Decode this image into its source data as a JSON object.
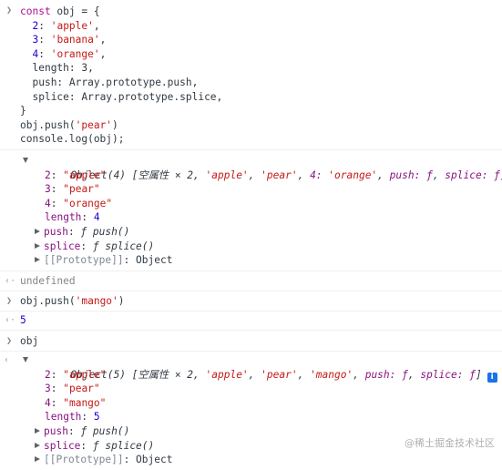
{
  "prompt_icon": "chevron-right-icon",
  "result_icon": "return-arrow-icon",
  "expand_icon": "expand-triangle-icon",
  "info_icon": "info-icon",
  "code1": {
    "l1_kw": "const",
    "l1_rest": " obj = {",
    "l2_num": "2",
    "l2_str": "'apple'",
    "l3_num": "3",
    "l3_str": "'banana'",
    "l4_num": "4",
    "l4_str": "'orange'",
    "l5": "length: 3,",
    "l6": "push: Array.prototype.push,",
    "l7": "splice: Array.prototype.splice,",
    "l8": "}",
    "l9_a": "obj.push(",
    "l9_str": "'pear'",
    "l9_b": ")",
    "l10": "console.log(obj);"
  },
  "obj1": {
    "label": "Object(4)",
    "summary_open": "[空属性 × 2, ",
    "s_apple": "'apple'",
    "s_pear": "'pear'",
    "s_4": "4: ",
    "s_orange": "'orange'",
    "s_push": "push: ƒ",
    "s_splice": "splice: ƒ",
    "summary_close": "]",
    "p2_key": "2",
    "p2_val": "\"apple\"",
    "p3_key": "3",
    "p3_val": "\"pear\"",
    "p4_key": "4",
    "p4_val": "\"orange\"",
    "len_key": "length",
    "len_val": "4",
    "push_key": "push",
    "push_val": "ƒ push()",
    "splice_key": "splice",
    "splice_val": "ƒ splice()",
    "proto_key": "[[Prototype]]",
    "proto_val": "Object"
  },
  "undefined_text": "undefined",
  "code2": {
    "a": "obj.push(",
    "str": "'mango'",
    "b": ")"
  },
  "result2": "5",
  "code3": "obj",
  "obj2": {
    "label": "Object(5)",
    "summary_open": "[空属性 × 2, ",
    "s_apple": "'apple'",
    "s_pear": "'pear'",
    "s_mango": "'mango'",
    "s_push": "push: ƒ",
    "s_splice": "splice: ƒ",
    "summary_close": "]",
    "p2_key": "2",
    "p2_val": "\"apple\"",
    "p3_key": "3",
    "p3_val": "\"pear\"",
    "p4_key": "4",
    "p4_val": "\"mango\"",
    "len_key": "length",
    "len_val": "5",
    "push_key": "push",
    "push_val": "ƒ push()",
    "splice_key": "splice",
    "splice_val": "ƒ splice()",
    "proto_key": "[[Prototype]]",
    "proto_val": "Object"
  },
  "watermark": "@稀土掘金技术社区"
}
